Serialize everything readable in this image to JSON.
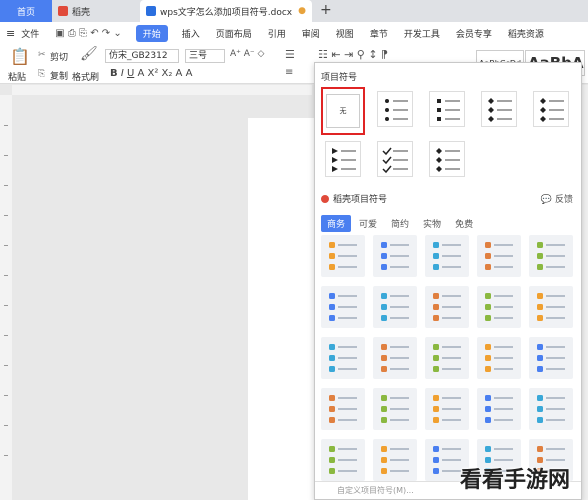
{
  "tabs": [
    {
      "label": "首页"
    },
    {
      "label": "稻壳"
    },
    {
      "label": "wps文字怎么添加项目符号.docx"
    }
  ],
  "tab_plus": "+",
  "modified_dot": "●",
  "menu": [
    "文件",
    "开始",
    "插入",
    "页面布局",
    "引用",
    "审阅",
    "视图",
    "章节",
    "开发工具",
    "会员专享",
    "稻壳资源"
  ],
  "toolbar": {
    "paste": "粘贴",
    "cut": "剪切",
    "copy": "复制",
    "format_painter": "格式刷",
    "font": "仿宋_GB2312",
    "size": "三号",
    "style1": "AaBbCcDd",
    "style2": "AaBbAa"
  },
  "panel": {
    "title": "项目符号",
    "none_label": "无",
    "section_title": "稻壳项目符号",
    "feedback": "反馈",
    "filters": [
      "商务",
      "可爱",
      "简约",
      "实物",
      "免费"
    ],
    "custom": "自定义项目符号(M)..."
  },
  "colors": {
    "accent": "#4a7ff0",
    "highlight": "#e02424"
  },
  "watermark": "看看手游网"
}
